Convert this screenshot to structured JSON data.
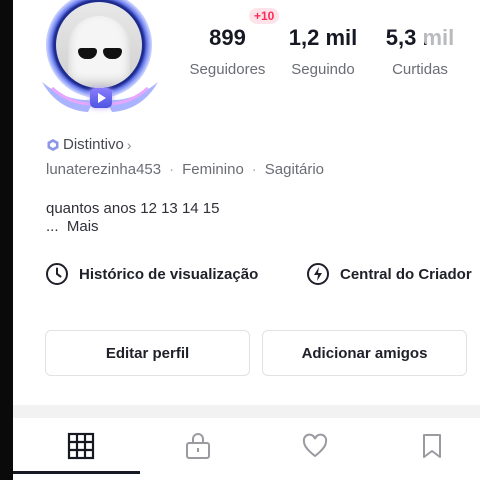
{
  "profile": {
    "followers_badge": "+10",
    "stats": [
      {
        "value": "899",
        "label": "Seguidores"
      },
      {
        "value": "1,2 mil",
        "label": "Seguindo"
      },
      {
        "value": "5,3 mil",
        "label": "Curtidas"
      }
    ],
    "badge_label": "Distintivo",
    "username": "lunaterezinha453",
    "gender": "Feminino",
    "sign": "Sagitário",
    "bio": "quantos anos 12 13 14 15",
    "more_prefix": "...",
    "more_label": "Mais"
  },
  "links": {
    "history": "Histórico de visualização",
    "creator": "Central do Criador"
  },
  "buttons": {
    "edit": "Editar perfil",
    "add_friends": "Adicionar amigos"
  },
  "tabs": [
    {
      "icon": "grid-icon",
      "active": true
    },
    {
      "icon": "lock-icon",
      "active": false
    },
    {
      "icon": "heart-icon",
      "active": false
    },
    {
      "icon": "bookmark-icon",
      "active": false
    }
  ],
  "colors": {
    "accent": "#fe2c55",
    "text": "#161823",
    "muted": "#6b6d75"
  }
}
